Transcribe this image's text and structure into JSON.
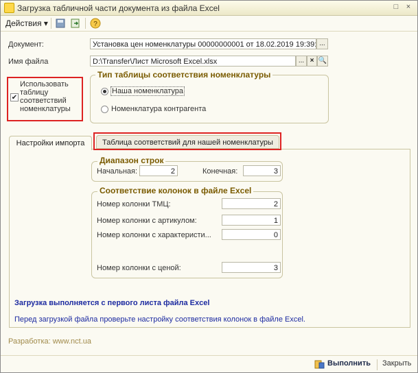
{
  "window": {
    "title": "Загрузка табличной части документа из файла Excel",
    "title_controls": [
      "□",
      "×"
    ]
  },
  "toolbar": {
    "actions_label": "Действия",
    "actions_arrow": "▾",
    "help_icon": "?"
  },
  "document": {
    "label": "Документ:",
    "value": "Установка цен номенклатуры 00000000001 от 18.02.2019 19:39:...",
    "select_btn": "..."
  },
  "file": {
    "label": "Имя файла",
    "value": "D:\\Transfer\\Лист Microsoft Excel.xlsx",
    "select_btn": "...",
    "clear_btn": "×",
    "open_btn": "🔍"
  },
  "use_table": {
    "label": "Использовать таблицу соответствий номенклатуры",
    "checked": true
  },
  "table_type": {
    "title": "Тип таблицы соответствия номенклатуры",
    "options": [
      {
        "label": "Наша номенклатура",
        "selected": true
      },
      {
        "label": "Номенклатура контрагента",
        "selected": false
      }
    ]
  },
  "tabs": [
    {
      "label": "Настройки импорта",
      "active": true
    },
    {
      "label": "Таблица соответствий для нашей номенклатуры",
      "active": false
    }
  ],
  "rows_range": {
    "title": "Диапазон строк",
    "start_label": "Начальная:",
    "start_value": "2",
    "end_label": "Конечная:",
    "end_value": "3"
  },
  "columns": {
    "title": "Соответствие колонок в файле Excel",
    "items": [
      {
        "label": "Номер колонки ТМЦ:",
        "value": "2"
      },
      {
        "label": "Номер колонки с артикулом:",
        "value": "1"
      },
      {
        "label": "Номер колонки с характеристи...",
        "value": "0"
      },
      {
        "label": "Номер колонки с ценой:",
        "value": "3"
      }
    ]
  },
  "info": {
    "bold": "Загрузка выполняется с первого листа файла Excel",
    "text": "Перед загрузкой файла проверьте настройку соответствия колонок в файле Excel."
  },
  "developer": "Разработка: www.nct.ua",
  "footer": {
    "run_label": "Выполнить",
    "close_label": "Закрыть"
  },
  "colors": {
    "highlight": "#dd2222",
    "info_text": "#1c2aa0",
    "group_title": "#7a5b00"
  }
}
